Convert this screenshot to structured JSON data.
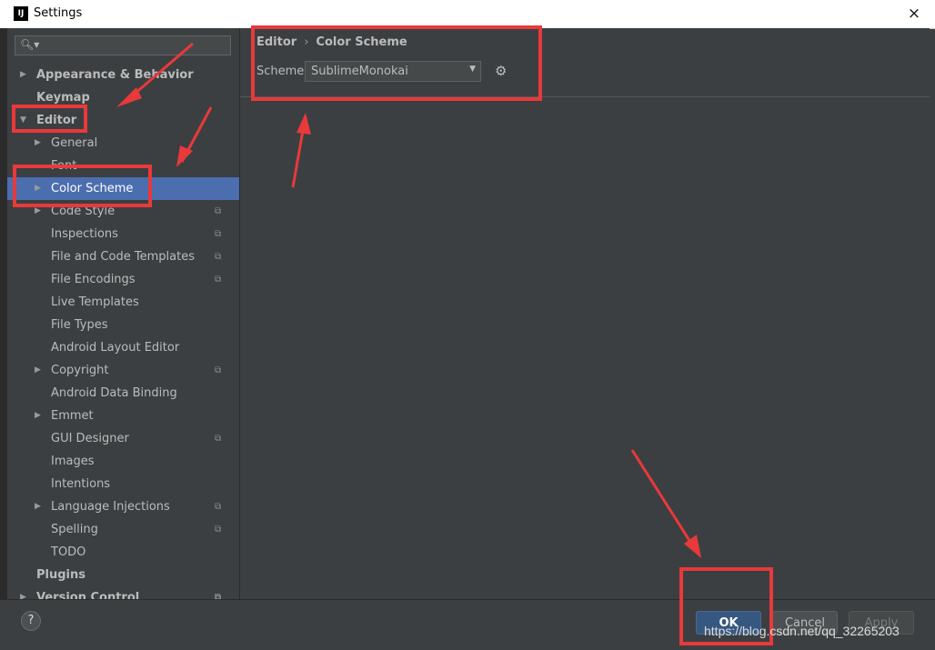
{
  "window": {
    "title": "Settings",
    "close_glyph": "×",
    "app_icon_text": "IJ"
  },
  "search": {
    "icon": "search-icon",
    "glyph": "🔍︎▾",
    "value": ""
  },
  "sidebar": {
    "items": [
      {
        "label": "Appearance & Behavior",
        "bold": true,
        "arrow": "▶",
        "name": "sidebar-item-appearance-behavior"
      },
      {
        "label": "Keymap",
        "bold": true,
        "arrow": "",
        "name": "sidebar-item-keymap"
      },
      {
        "label": "Editor",
        "bold": true,
        "arrow": "▼",
        "name": "sidebar-item-editor"
      },
      {
        "label": "General",
        "arrow": "▶",
        "name": "sidebar-item-general"
      },
      {
        "label": "Font",
        "arrow": "",
        "name": "sidebar-item-font"
      },
      {
        "label": "Color Scheme",
        "arrow": "▶",
        "selected": true,
        "name": "sidebar-item-color-scheme"
      },
      {
        "label": "Code Style",
        "arrow": "▶",
        "copy": true,
        "name": "sidebar-item-code-style"
      },
      {
        "label": "Inspections",
        "copy": true,
        "name": "sidebar-item-inspections"
      },
      {
        "label": "File and Code Templates",
        "copy": true,
        "name": "sidebar-item-file-code-templates"
      },
      {
        "label": "File Encodings",
        "copy": true,
        "name": "sidebar-item-file-encodings"
      },
      {
        "label": "Live Templates",
        "name": "sidebar-item-live-templates"
      },
      {
        "label": "File Types",
        "name": "sidebar-item-file-types"
      },
      {
        "label": "Android Layout Editor",
        "name": "sidebar-item-android-layout-editor"
      },
      {
        "label": "Copyright",
        "arrow": "▶",
        "copy": true,
        "name": "sidebar-item-copyright"
      },
      {
        "label": "Android Data Binding",
        "name": "sidebar-item-android-data-binding"
      },
      {
        "label": "Emmet",
        "arrow": "▶",
        "name": "sidebar-item-emmet"
      },
      {
        "label": "GUI Designer",
        "copy": true,
        "name": "sidebar-item-gui-designer"
      },
      {
        "label": "Images",
        "name": "sidebar-item-images"
      },
      {
        "label": "Intentions",
        "name": "sidebar-item-intentions"
      },
      {
        "label": "Language Injections",
        "arrow": "▶",
        "copy": true,
        "name": "sidebar-item-language-injections"
      },
      {
        "label": "Spelling",
        "copy": true,
        "name": "sidebar-item-spelling"
      },
      {
        "label": "TODO",
        "name": "sidebar-item-todo"
      },
      {
        "label": "Plugins",
        "bold": true,
        "name": "sidebar-item-plugins"
      },
      {
        "label": "Version Control",
        "bold": true,
        "arrow": "▶",
        "copy": true,
        "name": "sidebar-item-version-control"
      }
    ]
  },
  "content": {
    "breadcrumb": [
      "Editor",
      "Color Scheme"
    ],
    "breadcrumb_sep": "›",
    "scheme_label": "Scheme:",
    "scheme_value": "SublimeMonokai",
    "combo_arrow": "▼",
    "gear_glyph": "⚙"
  },
  "buttons": {
    "help": "?",
    "ok": "OK",
    "cancel": "Cancel",
    "apply": "Apply"
  },
  "watermark": "https://blog.csdn.net/qq_32265203",
  "colors": {
    "selection": "#4b6eaf",
    "annotation": "#e8393b",
    "ok_button": "#365880"
  }
}
